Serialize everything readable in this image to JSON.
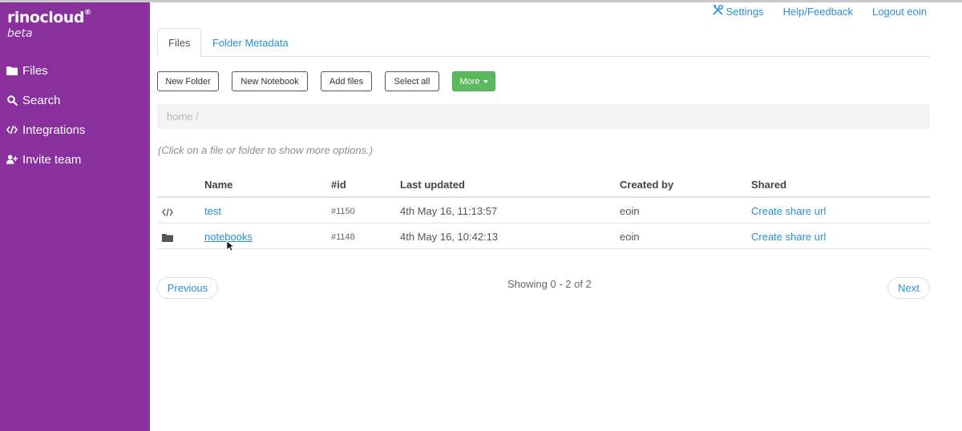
{
  "brand": {
    "logo": "rinocloud",
    "trademark": "®",
    "tag": "beta",
    "color": "#8a2f9e"
  },
  "sidebar": {
    "items": [
      {
        "label": "Files",
        "icon": "folder-icon"
      },
      {
        "label": "Search",
        "icon": "search-icon"
      },
      {
        "label": "Integrations",
        "icon": "code-icon"
      },
      {
        "label": "Invite team",
        "icon": "add-user-icon"
      }
    ]
  },
  "header": {
    "settings": "Settings",
    "help": "Help/Feedback",
    "logout": "Logout eoin"
  },
  "tabs": [
    {
      "label": "Files",
      "active": true
    },
    {
      "label": "Folder Metadata",
      "active": false
    }
  ],
  "toolbar": {
    "new_folder": "New Folder",
    "new_notebook": "New Notebook",
    "add_files": "Add files",
    "select_all": "Select all",
    "more": "More",
    "more_color": "#5cb85c"
  },
  "breadcrumb": {
    "path": "home /"
  },
  "hint": "(Click on a file or folder to show more options.)",
  "table": {
    "columns": [
      "Name",
      "#id",
      "Last updated",
      "Created by",
      "Shared"
    ],
    "rows": [
      {
        "icon": "code-icon",
        "name": "test",
        "id": "#1150",
        "updated": "4th May 16, 11:13:57",
        "created_by": "eoin",
        "shared": "Create share url"
      },
      {
        "icon": "folder-icon",
        "name": "notebooks",
        "id": "#1148",
        "updated": "4th May 16, 10:42:13",
        "created_by": "eoin",
        "shared": "Create share url"
      }
    ]
  },
  "pagination": {
    "previous": "Previous",
    "showing": "Showing 0 - 2 of 2",
    "next": "Next"
  },
  "link_color": "#2a8fd4"
}
